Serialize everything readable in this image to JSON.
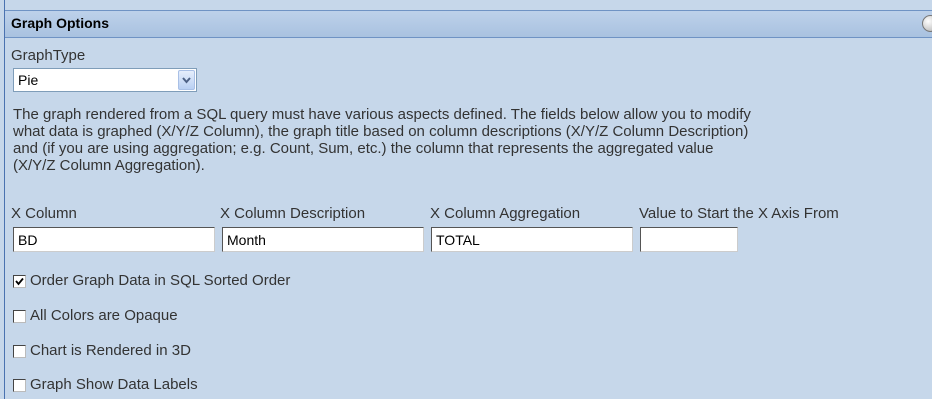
{
  "header": {
    "title": "Graph Options"
  },
  "graph_type": {
    "label": "GraphType",
    "selected": "Pie"
  },
  "description": [
    "The graph rendered from a SQL query must have various aspects defined. The fields below allow you to modify",
    "what data is graphed (X/Y/Z Column), the graph title based on column descriptions (X/Y/Z Column Description)",
    "and (if you are using aggregation; e.g. Count, Sum, etc.) the column that represents the aggregated value",
    "(X/Y/Z Column Aggregation)."
  ],
  "fields": {
    "x_column": {
      "label": "X Column",
      "value": "BD"
    },
    "x_desc": {
      "label": "X Column Description",
      "value": "Month"
    },
    "x_agg": {
      "label": "X Column Aggregation",
      "value": "TOTAL"
    },
    "x_start": {
      "label": "Value to Start the X Axis From",
      "value": ""
    }
  },
  "options": {
    "sorted": {
      "label": "Order Graph Data in SQL Sorted Order",
      "checked": true
    },
    "opaque": {
      "label": "All Colors are Opaque",
      "checked": false
    },
    "three_d": {
      "label": "Chart is Rendered in 3D",
      "checked": false
    },
    "data_labels": {
      "label": "Graph Show Data Labels",
      "checked": false
    }
  }
}
